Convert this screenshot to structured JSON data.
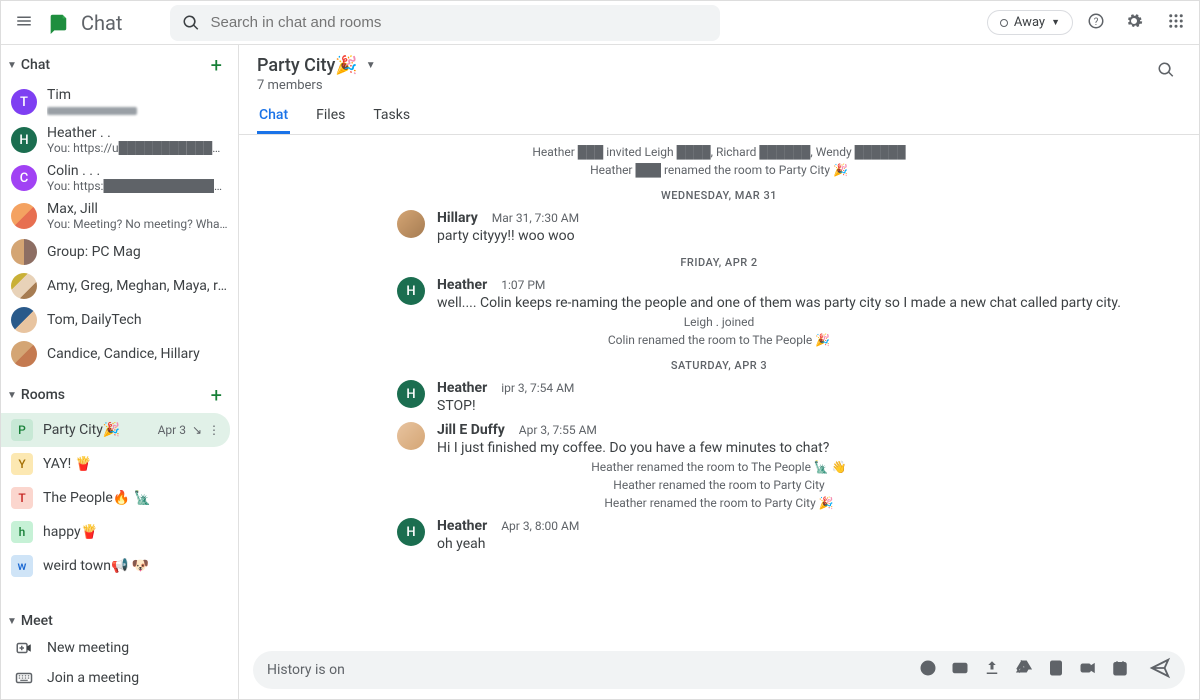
{
  "header": {
    "app_title": "Chat",
    "search_placeholder": "Search in chat and rooms",
    "status_label": "Away"
  },
  "sidebar": {
    "sections": {
      "chat_label": "Chat",
      "rooms_label": "Rooms",
      "meet_label": "Meet"
    },
    "chats": [
      {
        "name": "Tim",
        "preview": "████████████"
      },
      {
        "name": "Heather . .",
        "preview": "You: https://u██████████████████"
      },
      {
        "name": "Colin . . .",
        "preview": "You: https:█████████████████4..."
      },
      {
        "name": "Max, Jill",
        "preview": "You: Meeting? No meeting? What's the g..."
      },
      {
        "name": "Group: PC Mag",
        "preview": ""
      },
      {
        "name": "Amy, Greg, Meghan, Maya, randal...",
        "preview": ""
      },
      {
        "name": "Tom, DailyTech",
        "preview": ""
      },
      {
        "name": "Candice, Candice, Hillary",
        "preview": ""
      }
    ],
    "rooms": [
      {
        "letter": "P",
        "name": "Party City🎉",
        "date": "Apr 3",
        "selected": true
      },
      {
        "letter": "Y",
        "name": "YAY! 🍟",
        "selected": false
      },
      {
        "letter": "T",
        "name": "The People🔥 🗽",
        "selected": false
      },
      {
        "letter": "h",
        "name": "happy🍟",
        "selected": false
      },
      {
        "letter": "w",
        "name": "weird town📢 🐶",
        "selected": false
      }
    ],
    "meet": {
      "new_meeting": "New meeting",
      "join_meeting": "Join a meeting"
    }
  },
  "room_view": {
    "title": "Party City🎉",
    "subtitle": "7 members",
    "tabs": {
      "chat": "Chat",
      "files": "Files",
      "tasks": "Tasks"
    },
    "search_icon": "search-icon",
    "system_events": {
      "invited": "Heather ███ invited Leigh ████, Richard ██████, Wendy ██████",
      "renamed_party": "Heather ███ renamed the room to Party City 🎉",
      "leigh_joined": "Leigh .        joined",
      "colin_renamed": "Colin        renamed the room to The People 🎉",
      "heather_ren_people": "Heather        renamed the room to The People 🗽 👋",
      "heather_ren_party1": "Heather        renamed the room to Party City",
      "heather_ren_party2": "Heather        renamed the room to Party City 🎉"
    },
    "dates": {
      "wed": "WEDNESDAY, MAR 31",
      "fri": "FRIDAY, APR 2",
      "sat": "SATURDAY, APR 3"
    },
    "messages": [
      {
        "author": "Hillary",
        "time": "Mar 31, 7:30 AM",
        "text": "party cityyy!! woo woo"
      },
      {
        "author": "Heather",
        "time": "1:07 PM",
        "text": "well.... Colin keeps re-naming the people and one of them was party city so I made a new chat called party city."
      },
      {
        "author": "Heather",
        "time": "ipr 3, 7:54 AM",
        "text": "STOP!"
      },
      {
        "author": "Jill E Duffy",
        "time": "Apr 3, 7:55 AM",
        "text": "Hi I just finished my coffee. Do you have a few minutes to chat?"
      },
      {
        "author": "Heather",
        "time": "Apr 3, 8:00 AM",
        "text": "oh yeah"
      }
    ],
    "compose_hint": "History is on"
  }
}
